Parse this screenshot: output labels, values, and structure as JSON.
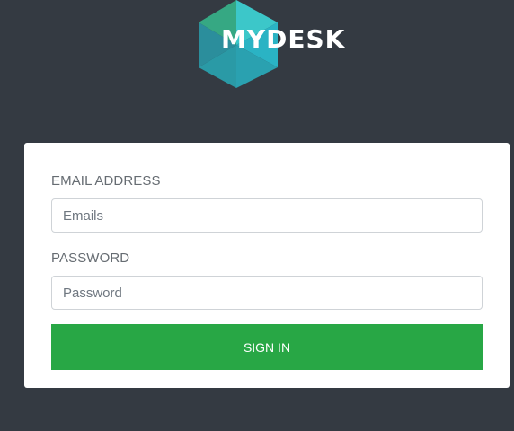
{
  "brand": {
    "name": "MYDESK",
    "colors": {
      "teal_light": "#3cc7c9",
      "teal_mid": "#2aa7b8",
      "green": "#36a883",
      "dark_teal": "#2b8e9c"
    }
  },
  "login": {
    "email_label": "EMAIL ADDRESS",
    "email_placeholder": "Emails",
    "email_value": "",
    "password_label": "PASSWORD",
    "password_placeholder": "Password",
    "password_value": "",
    "submit_label": "SIGN IN",
    "submit_color": "#28a745"
  },
  "theme": {
    "background": "#343a42",
    "card": "#ffffff"
  }
}
